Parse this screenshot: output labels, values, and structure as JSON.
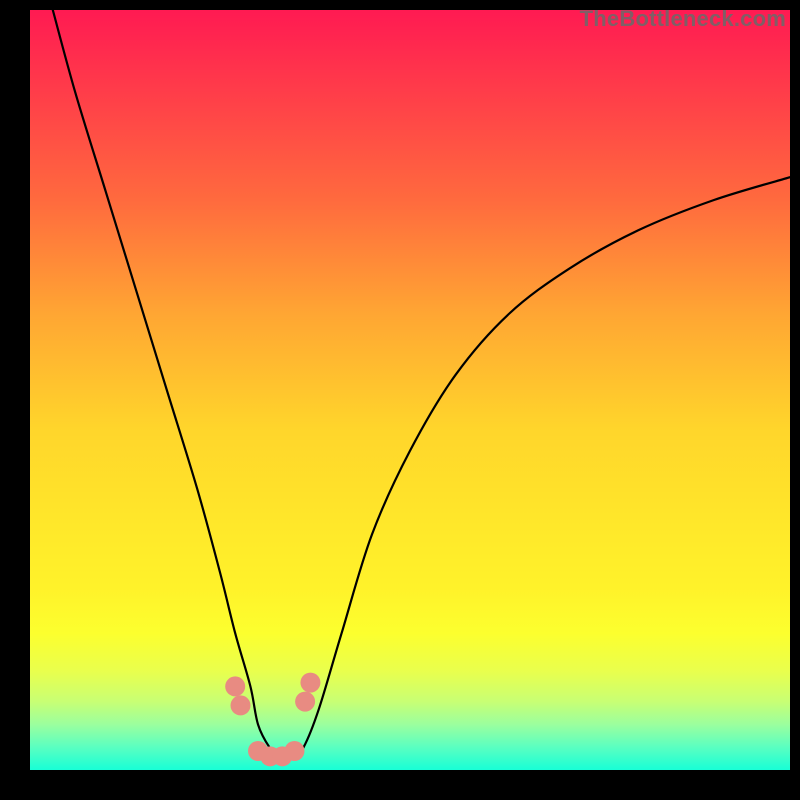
{
  "watermark": "TheBottleneck.com",
  "chart_data": {
    "type": "line",
    "title": "",
    "xlabel": "",
    "ylabel": "",
    "xlim": [
      0,
      100
    ],
    "ylim": [
      0,
      100
    ],
    "grid": false,
    "legend": false,
    "series": [
      {
        "name": "bottleneck-curve",
        "x": [
          3,
          6,
          10,
          14,
          18,
          22,
          25,
          27,
          29,
          30,
          31.5,
          33,
          34.5,
          36,
          38,
          41,
          45,
          50,
          56,
          63,
          71,
          80,
          90,
          100
        ],
        "y": [
          100,
          89,
          76,
          63,
          50,
          37,
          26,
          18,
          11,
          6,
          3,
          1.5,
          1.5,
          3,
          8,
          18,
          31,
          42,
          52,
          60,
          66,
          71,
          75,
          78
        ]
      }
    ],
    "markers": [
      {
        "name": "shoulder-left-upper",
        "x": 27.0,
        "y": 11.0,
        "color": "#e88b82"
      },
      {
        "name": "shoulder-left-lower",
        "x": 27.7,
        "y": 8.5,
        "color": "#e88b82"
      },
      {
        "name": "valley-1",
        "x": 30.0,
        "y": 2.5,
        "color": "#e88b82"
      },
      {
        "name": "valley-2",
        "x": 31.6,
        "y": 1.8,
        "color": "#e88b82"
      },
      {
        "name": "valley-3",
        "x": 33.2,
        "y": 1.8,
        "color": "#e88b82"
      },
      {
        "name": "valley-4",
        "x": 34.8,
        "y": 2.5,
        "color": "#e88b82"
      },
      {
        "name": "shoulder-right-lower",
        "x": 36.2,
        "y": 9.0,
        "color": "#e88b82"
      },
      {
        "name": "shoulder-right-upper",
        "x": 36.9,
        "y": 11.5,
        "color": "#e88b82"
      }
    ],
    "curve_color": "#000000",
    "curve_width": 2.2
  }
}
